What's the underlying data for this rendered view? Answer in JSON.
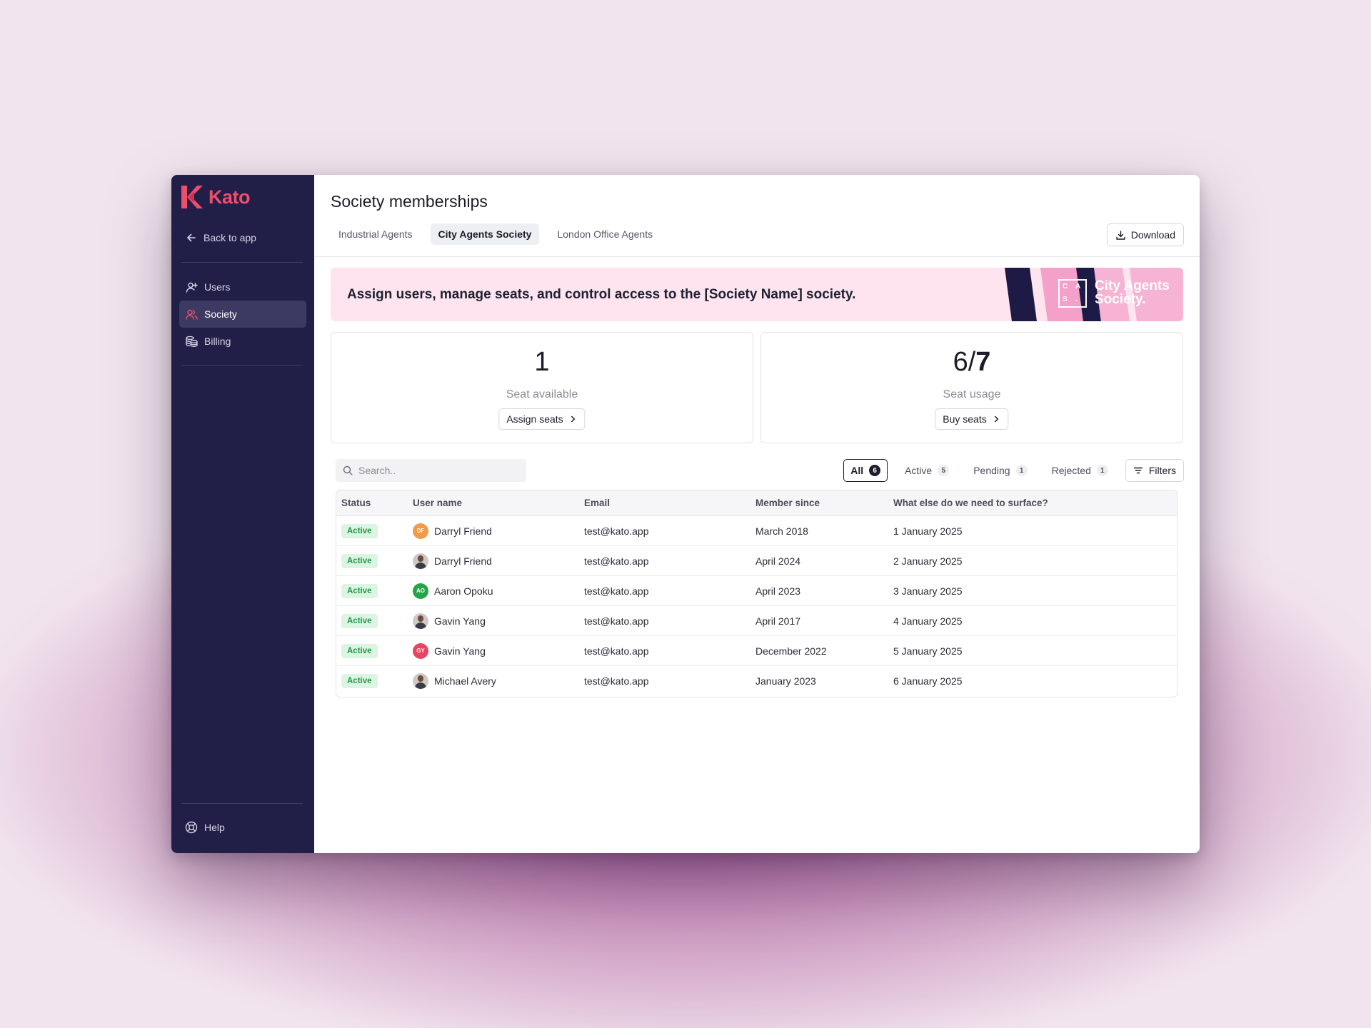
{
  "app": {
    "brand": "Kato",
    "accent": "#ef4e6a",
    "sidebar_bg": "#211e48"
  },
  "sidebar": {
    "back": "Back to app",
    "items": [
      {
        "label": "Users",
        "icon": "user-plus-icon",
        "active": false
      },
      {
        "label": "Society",
        "icon": "users-icon",
        "active": true
      },
      {
        "label": "Billing",
        "icon": "coins-icon",
        "active": false
      }
    ],
    "help": "Help"
  },
  "header": {
    "title": "Society memberships",
    "tabs": [
      {
        "label": "Industrial Agents",
        "active": false
      },
      {
        "label": "City Agents Society",
        "active": true
      },
      {
        "label": "London Office Agents",
        "active": false
      }
    ],
    "download": "Download"
  },
  "banner": {
    "text": "Assign users, manage seats, and control access to the [Society Name] society.",
    "brand_line1": "City Agents",
    "brand_line2": "Society.",
    "logo_letters": [
      "C",
      "A",
      "S",
      "."
    ]
  },
  "cards": {
    "available": {
      "value": "1",
      "label": "Seat available",
      "button": "Assign seats"
    },
    "usage": {
      "used": "6/",
      "total": "7",
      "label": "Seat usage",
      "button": "Buy seats"
    }
  },
  "search": {
    "placeholder": "Search.."
  },
  "filters": {
    "chips": [
      {
        "label": "All",
        "count": "6",
        "active": true
      },
      {
        "label": "Active",
        "count": "5",
        "active": false
      },
      {
        "label": "Pending",
        "count": "1",
        "active": false
      },
      {
        "label": "Rejected",
        "count": "1",
        "active": false
      }
    ],
    "button": "Filters"
  },
  "table": {
    "columns": [
      "Status",
      "User name",
      "Email",
      "Member since",
      "What else do we need to surface?"
    ],
    "rows": [
      {
        "status": "Active",
        "initials": "DF",
        "avatar_color": "#f2994a",
        "name": "Darryl Friend",
        "email": "test@kato.app",
        "since": "March 2018",
        "extra": "1 January 2025"
      },
      {
        "status": "Active",
        "initials": "",
        "avatar_color": "photo",
        "name": "Darryl Friend",
        "email": "test@kato.app",
        "since": "April 2024",
        "extra": "2 January 2025"
      },
      {
        "status": "Active",
        "initials": "AO",
        "avatar_color": "#27a348",
        "name": "Aaron Opoku",
        "email": "test@kato.app",
        "since": "April 2023",
        "extra": "3 January 2025"
      },
      {
        "status": "Active",
        "initials": "",
        "avatar_color": "photo",
        "name": "Gavin Yang",
        "email": "test@kato.app",
        "since": "April 2017",
        "extra": "4 January 2025"
      },
      {
        "status": "Active",
        "initials": "GY",
        "avatar_color": "#e8435f",
        "name": "Gavin Yang",
        "email": "test@kato.app",
        "since": "December 2022",
        "extra": "5 January 2025"
      },
      {
        "status": "Active",
        "initials": "",
        "avatar_color": "photo",
        "name": "Michael Avery",
        "email": "test@kato.app",
        "since": "January 2023",
        "extra": "6 January 2025"
      }
    ]
  }
}
